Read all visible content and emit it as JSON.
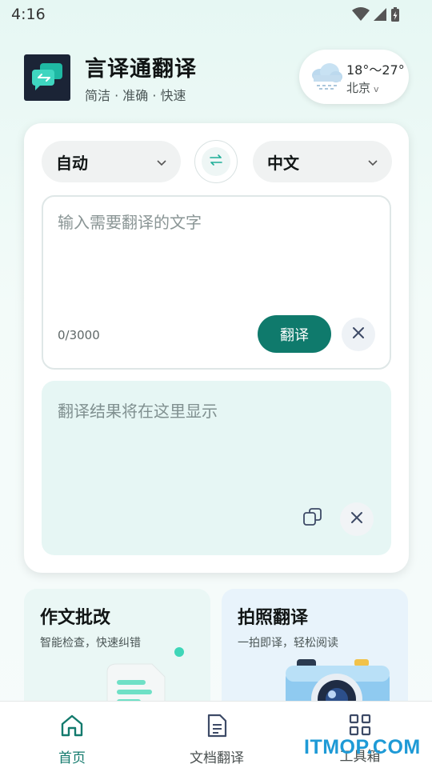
{
  "status_bar": {
    "time": "4:16",
    "icons": [
      "wifi-icon",
      "signal-icon",
      "battery-charging-icon"
    ]
  },
  "header": {
    "title": "言译通翻译",
    "subtitle": "简洁 · 准确 · 快速",
    "logo_icon": "chat-translate-icon"
  },
  "weather": {
    "temperature": "18°～27°",
    "city": "北京",
    "dropdown_glyph": "v",
    "icon": "cloud-rain-icon"
  },
  "translator": {
    "source_language": "自动",
    "target_language": "中文",
    "input_placeholder": "输入需要翻译的文字",
    "input_value": "",
    "char_count": "0/3000",
    "translate_label": "翻译",
    "result_placeholder": "翻译结果将在这里显示"
  },
  "features": [
    {
      "title": "作文批改",
      "description": "智能检查，快速纠错",
      "icon": "document-check-icon"
    },
    {
      "title": "拍照翻译",
      "description": "一拍即译，轻松阅读",
      "icon": "camera-icon"
    }
  ],
  "bottom_nav": [
    {
      "label": "首页",
      "icon": "home-icon",
      "active": true
    },
    {
      "label": "文档翻译",
      "icon": "document-icon",
      "active": false
    },
    {
      "label": "工具箱",
      "icon": "grid-icon",
      "active": false
    }
  ],
  "watermark": "ITMOP.COM",
  "colors": {
    "accent": "#0f7a6c",
    "result_background": "#e6f6f4",
    "watermark": "#1e9ad6"
  }
}
